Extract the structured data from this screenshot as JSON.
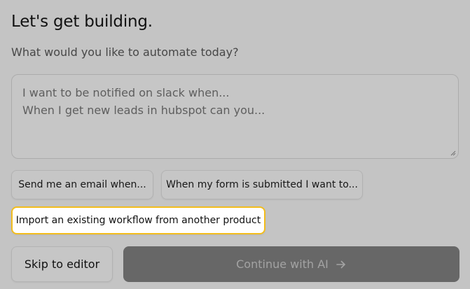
{
  "header": {
    "title": "Let's get building.",
    "subtitle": "What would you like to automate today?"
  },
  "prompt": {
    "placeholder_lines": [
      "I want to be notified on slack when...",
      "When I get new leads in hubspot can you..."
    ]
  },
  "suggestions": [
    {
      "label": "Send me an email when..."
    },
    {
      "label": "When my form is submitted I want to..."
    },
    {
      "label": "Import an existing workflow from another product",
      "highlighted": true
    }
  ],
  "actions": {
    "skip_label": "Skip to editor",
    "continue_label": "Continue with AI",
    "continue_icon": "arrow-right-icon",
    "continue_disabled": true
  },
  "colors": {
    "overlay_background": "#c4c4c4",
    "highlight_border": "#f2bd1d",
    "continue_background": "#676767"
  }
}
